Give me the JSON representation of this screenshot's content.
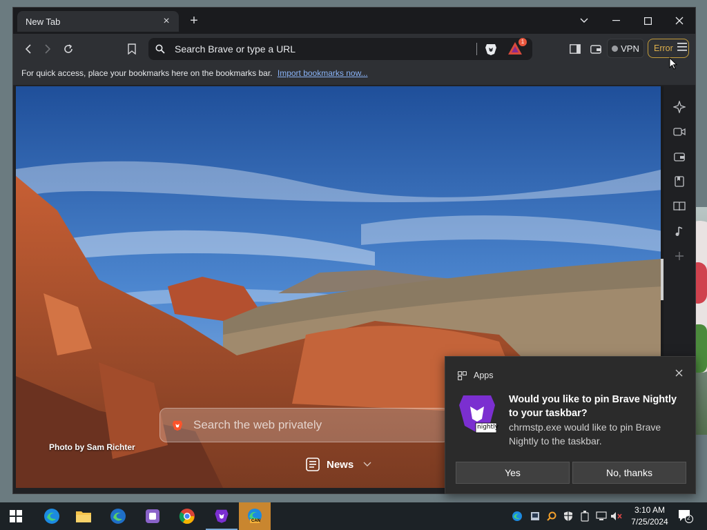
{
  "tab": {
    "title": "New Tab",
    "close": "×",
    "new": "+"
  },
  "window_controls": {
    "tabsearch": "⌄",
    "minimize": "—",
    "maximize": "☐",
    "close": "✕"
  },
  "omnibox": {
    "placeholder": "Search Brave or type a URL"
  },
  "rewards": {
    "badge": "1"
  },
  "vpn": {
    "label": "VPN"
  },
  "menu": {
    "error_label": "Error"
  },
  "bookmarks_bar": {
    "text": "For quick access, place your bookmarks here on the bookmarks bar.",
    "link": "Import bookmarks now..."
  },
  "ntp": {
    "photo_credit": "Photo by Sam Richter",
    "search_placeholder": "Search the web privately",
    "news_label": "News"
  },
  "sidebar": {
    "items": [
      "leo-icon",
      "talk-icon",
      "wallet-icon",
      "bookmarks-icon",
      "reading-list-icon",
      "playlist-icon",
      "add-icon"
    ]
  },
  "toast": {
    "app_label": "Apps",
    "title": "Would you like to pin Brave Nightly to your taskbar?",
    "body": "chrmstp.exe would like to pin Brave Nightly to the taskbar.",
    "logo_text": "nightly",
    "yes": "Yes",
    "no": "No, thanks"
  },
  "taskbar": {
    "apps": [
      "windows-start",
      "edge",
      "file-explorer",
      "edge-dev",
      "app-purple",
      "chrome",
      "brave-nightly",
      "edge-can"
    ],
    "edge_can_label": "CAN",
    "time": "3:10 AM",
    "date": "7/25/2024",
    "notifications": "2"
  },
  "colors": {
    "accent_error": "#dfb04d",
    "link": "#8ab4f8",
    "brave_orange": "#fb542b",
    "nightly_purple": "#7b2fd0"
  }
}
